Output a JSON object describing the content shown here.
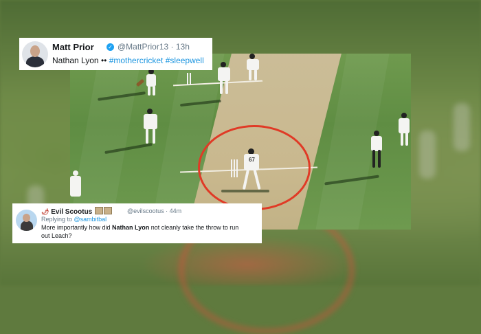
{
  "tweet1": {
    "name": "Matt Prior",
    "handle": "@MattPrior13",
    "time": "13h",
    "text_prefix": "Nathan Lyon ",
    "emoji": "••",
    "hashtags": "#mothercricket #sleepwell",
    "verified_icon": "verified-badge"
  },
  "tweet2": {
    "name": "Evil Scootus",
    "handle": "@evilscootus",
    "time": "44m",
    "reply_prefix": "Replying to ",
    "reply_handle": "@sambitbal",
    "line1_a": "More importantly how did ",
    "line1_bold": "Nathan Lyon",
    "line1_b": " not cleanly take the throw to run",
    "line2": "out Leach?"
  },
  "photo": {
    "player_number": "67",
    "highlight_color": "#e03a26"
  }
}
